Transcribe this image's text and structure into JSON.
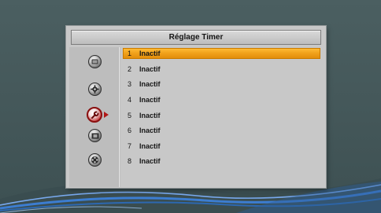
{
  "dialog": {
    "title": "Réglage Timer"
  },
  "sidebar": {
    "items": [
      {
        "icon": "screen-icon",
        "active": false
      },
      {
        "icon": "gear-icon",
        "active": false
      },
      {
        "icon": "wrench-icon",
        "active": true
      },
      {
        "icon": "film-icon",
        "active": false
      },
      {
        "icon": "film-reel-icon",
        "active": false
      }
    ]
  },
  "timers": [
    {
      "number": "1",
      "status": "Inactif",
      "selected": true
    },
    {
      "number": "2",
      "status": "Inactif",
      "selected": false
    },
    {
      "number": "3",
      "status": "Inactif",
      "selected": false
    },
    {
      "number": "4",
      "status": "Inactif",
      "selected": false
    },
    {
      "number": "5",
      "status": "Inactif",
      "selected": false
    },
    {
      "number": "6",
      "status": "Inactif",
      "selected": false
    },
    {
      "number": "7",
      "status": "Inactif",
      "selected": false
    },
    {
      "number": "8",
      "status": "Inactif",
      "selected": false
    }
  ],
  "colors": {
    "background": "#465a5c",
    "panel": "#c8c8c8",
    "highlight": "#f0a01a",
    "active_icon": "#b01818",
    "wave_blue": "#2a6fc8"
  }
}
